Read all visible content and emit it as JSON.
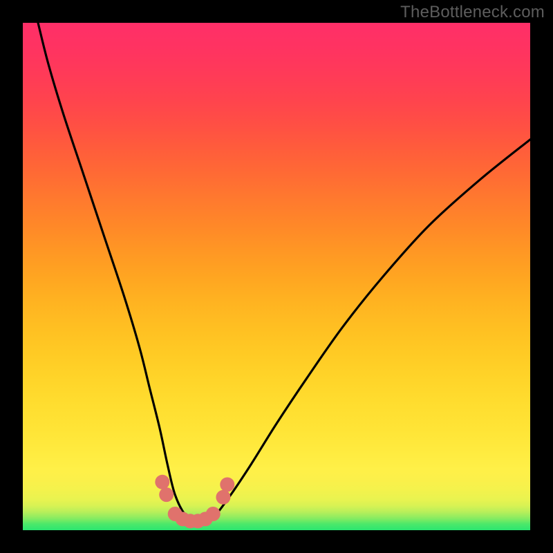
{
  "watermark": "TheBottleneck.com",
  "chart_data": {
    "type": "line",
    "title": "",
    "xlabel": "",
    "ylabel": "",
    "xlim": [
      0,
      100
    ],
    "ylim": [
      0,
      100
    ],
    "grid": false,
    "legend": false,
    "background_gradient": {
      "orientation": "vertical",
      "stops": [
        {
          "pos": 0,
          "color": "#2be670"
        },
        {
          "pos": 6,
          "color": "#e8f350"
        },
        {
          "pos": 12,
          "color": "#fff048"
        },
        {
          "pos": 50,
          "color": "#ffa521"
        },
        {
          "pos": 100,
          "color": "#ff2f68"
        }
      ]
    },
    "series": [
      {
        "name": "bottleneck-curve",
        "color": "#000000",
        "x": [
          3,
          5,
          8,
          12,
          16,
          20,
          23,
          25,
          27,
          28.5,
          30,
          32,
          34,
          36,
          38,
          41,
          45,
          50,
          56,
          63,
          71,
          80,
          90,
          100
        ],
        "y": [
          100,
          92,
          82,
          70,
          58,
          46,
          36,
          28,
          20,
          13,
          7,
          3,
          1.5,
          1.5,
          3,
          7,
          13,
          21,
          30,
          40,
          50,
          60,
          69,
          77
        ]
      }
    ],
    "markers": [
      {
        "name": "bottleneck-marker-dots",
        "color": "#e0726c",
        "points": [
          {
            "x": 27.5,
            "y": 9.5
          },
          {
            "x": 28.3,
            "y": 7.0
          },
          {
            "x": 30.0,
            "y": 3.2
          },
          {
            "x": 31.5,
            "y": 2.2
          },
          {
            "x": 33.0,
            "y": 1.8
          },
          {
            "x": 34.5,
            "y": 1.8
          },
          {
            "x": 36.0,
            "y": 2.2
          },
          {
            "x": 37.5,
            "y": 3.2
          },
          {
            "x": 39.5,
            "y": 6.5
          },
          {
            "x": 40.3,
            "y": 9.0
          }
        ]
      }
    ]
  }
}
